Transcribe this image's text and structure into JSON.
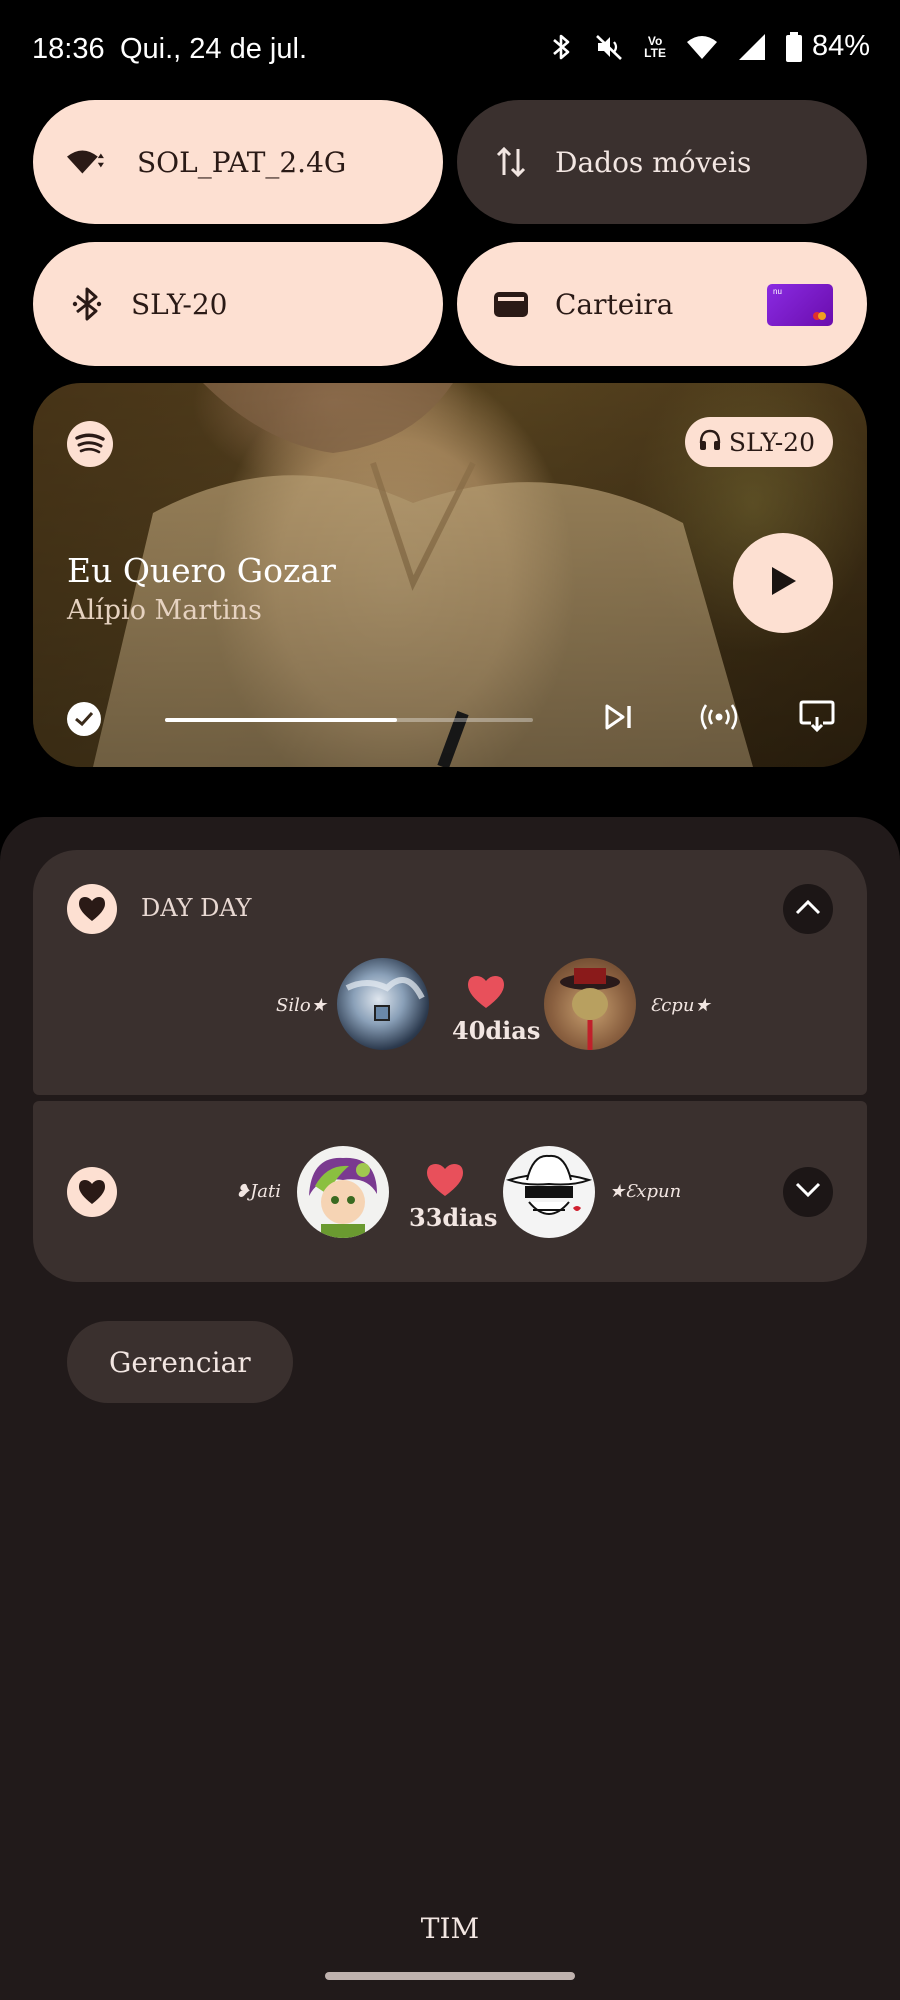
{
  "status_bar": {
    "time": "18:36",
    "date": "Qui., 24 de jul.",
    "battery": "84%",
    "icons": [
      "bluetooth-icon",
      "vibrate-off-icon",
      "volte-icon",
      "wifi-icon",
      "signal-icon",
      "battery-icon"
    ],
    "volte_label_top": "Vo",
    "volte_label_bottom": "LTE"
  },
  "quick_tiles": [
    {
      "label": "SOL_PAT_2.4G",
      "icon": "wifi-icon",
      "state": "on"
    },
    {
      "label": "Dados móveis",
      "icon": "mobile-data-icon",
      "state": "off"
    },
    {
      "label": "SLY-20",
      "icon": "bluetooth-icon",
      "state": "on"
    },
    {
      "label": "Carteira",
      "icon": "wallet-icon",
      "state": "on"
    }
  ],
  "wallet_card_brand": "nu",
  "media": {
    "app_icon": "spotify-icon",
    "output_device": "SLY-20",
    "title": "Eu Quero Gozar",
    "artist": "Alípio Martins",
    "progress": 0.63,
    "controls": [
      "saved-check-icon",
      "skip-next-icon",
      "broadcast-icon",
      "cast-icon",
      "play-icon"
    ]
  },
  "notifications": [
    {
      "app_name": "DAY DAY",
      "expanded": true,
      "left_nick": "Silo★",
      "right_nick": "Ɛcpu★",
      "days": "40dias"
    },
    {
      "app_name": "",
      "expanded": false,
      "left_nick": "❥Jati",
      "right_nick": "★Ɛxpun",
      "days": "33dias"
    }
  ],
  "manage_label": "Gerenciar",
  "carrier": "TIM",
  "colors": {
    "tile_on": "#fde0d2",
    "tile_off": "#3a302e",
    "panel": "#211a1a",
    "heart": "#e8505b"
  }
}
